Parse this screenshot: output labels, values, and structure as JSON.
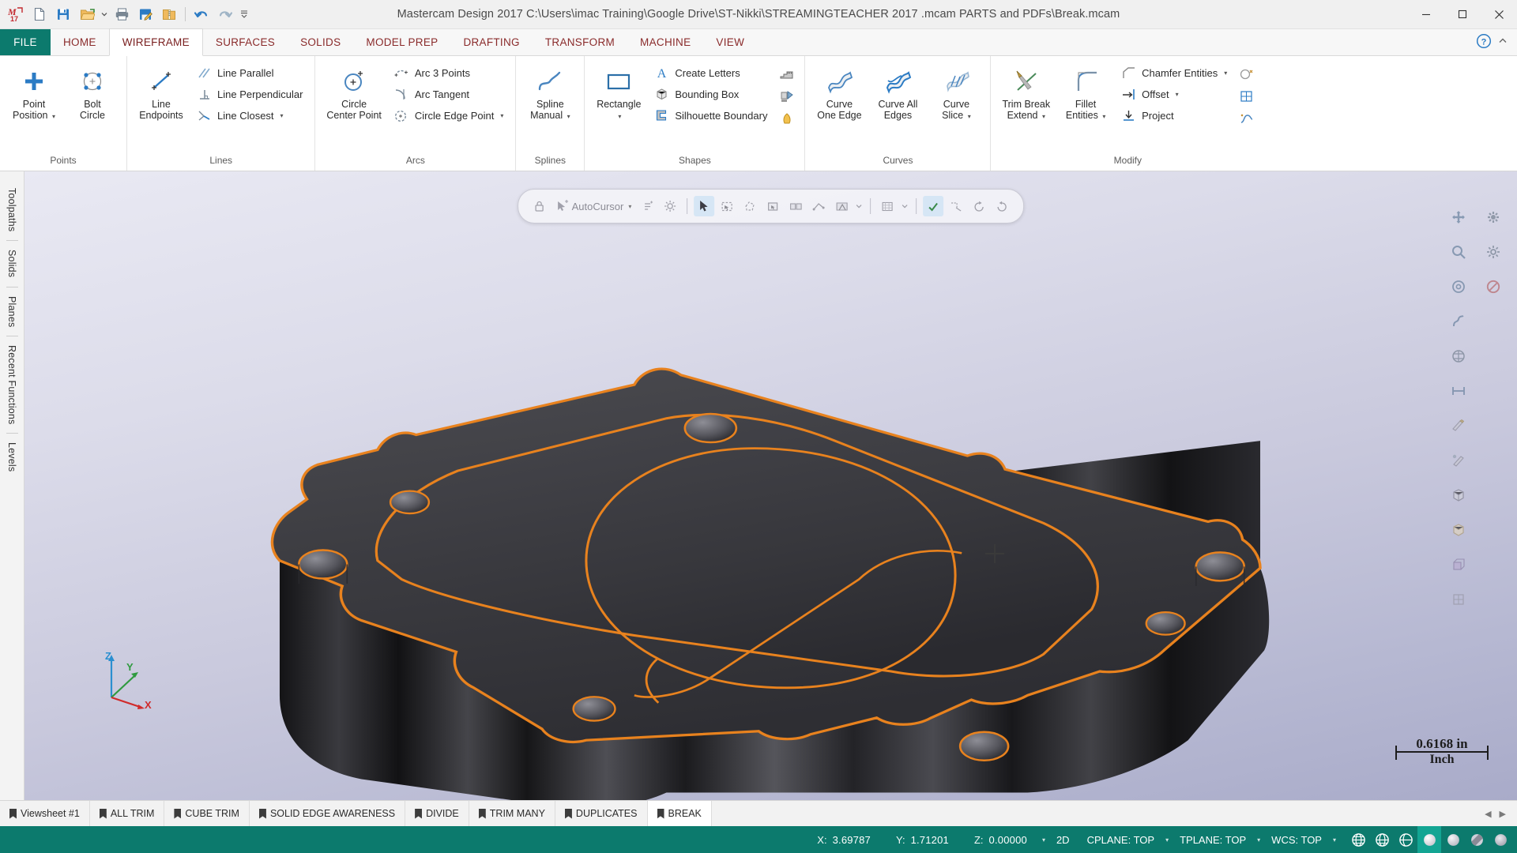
{
  "window": {
    "title": "Mastercam Design 2017  C:\\Users\\imac Training\\Google Drive\\ST-Nikki\\STREAMINGTEACHER 2017 .mcam PARTS and PDFs\\Break.mcam",
    "app_logo": "mastercam-17-logo",
    "minimize": "minimize-icon",
    "maximize": "maximize-icon",
    "close": "close-icon"
  },
  "quick_access": [
    {
      "name": "new-file-icon",
      "tip": "New"
    },
    {
      "name": "save-icon",
      "tip": "Save"
    },
    {
      "name": "open-folder-icon",
      "tip": "Open"
    },
    {
      "name": "open-dropdown-icon",
      "tip": "Open recent"
    },
    {
      "name": "print-icon",
      "tip": "Print"
    },
    {
      "name": "save-as-icon",
      "tip": "Save As"
    },
    {
      "name": "zip2go-icon",
      "tip": "Zip2Go"
    },
    {
      "name": "undo-icon",
      "tip": "Undo"
    },
    {
      "name": "redo-icon",
      "tip": "Redo"
    },
    {
      "name": "customize-qat-icon",
      "tip": "Customize Quick Access Toolbar"
    }
  ],
  "tabs": [
    {
      "label": "FILE",
      "kind": "file"
    },
    {
      "label": "HOME",
      "kind": "normal"
    },
    {
      "label": "WIREFRAME",
      "kind": "active"
    },
    {
      "label": "SURFACES",
      "kind": "normal"
    },
    {
      "label": "SOLIDS",
      "kind": "normal"
    },
    {
      "label": "MODEL PREP",
      "kind": "normal"
    },
    {
      "label": "DRAFTING",
      "kind": "normal"
    },
    {
      "label": "TRANSFORM",
      "kind": "normal"
    },
    {
      "label": "MACHINE",
      "kind": "normal"
    },
    {
      "label": "VIEW",
      "kind": "normal"
    }
  ],
  "help": {
    "icon": "help-question-icon",
    "collapse": "collapse-ribbon-icon"
  },
  "ribbon": {
    "groups": [
      {
        "name": "Points",
        "big": [
          {
            "label": "Point\nPosition",
            "icon": "point-position-icon",
            "caret": true
          },
          {
            "label": "Bolt\nCircle",
            "icon": "bolt-circle-icon",
            "caret": false
          }
        ],
        "small": []
      },
      {
        "name": "Lines",
        "big": [
          {
            "label": "Line\nEndpoints",
            "icon": "line-endpoints-icon",
            "caret": false
          }
        ],
        "small": [
          {
            "label": "Line Parallel",
            "icon": "line-parallel-icon",
            "caret": false
          },
          {
            "label": "Line Perpendicular",
            "icon": "line-perpendicular-icon",
            "caret": false
          },
          {
            "label": "Line Closest",
            "icon": "line-closest-icon",
            "caret": true
          }
        ]
      },
      {
        "name": "Arcs",
        "big": [
          {
            "label": "Circle\nCenter Point",
            "icon": "circle-center-point-icon",
            "caret": false
          }
        ],
        "small": [
          {
            "label": "Arc 3 Points",
            "icon": "arc-3-points-icon",
            "caret": false
          },
          {
            "label": "Arc Tangent",
            "icon": "arc-tangent-icon",
            "caret": false
          },
          {
            "label": "Circle Edge Point",
            "icon": "circle-edge-point-icon",
            "caret": true
          }
        ]
      },
      {
        "name": "Splines",
        "big": [
          {
            "label": "Spline\nManual",
            "icon": "spline-manual-icon",
            "caret": true
          }
        ],
        "small": []
      },
      {
        "name": "Shapes",
        "big": [
          {
            "label": "Rectangle",
            "icon": "rectangle-icon",
            "caret": true
          }
        ],
        "small": [
          {
            "label": "Create Letters",
            "icon": "create-letters-icon",
            "caret": false
          },
          {
            "label": "Bounding Box",
            "icon": "bounding-box-icon",
            "caret": false
          },
          {
            "label": "Silhouette Boundary",
            "icon": "silhouette-boundary-icon",
            "caret": false
          }
        ],
        "icons": [
          {
            "name": "stair-shape-icon"
          },
          {
            "name": "relief-shape-icon"
          },
          {
            "name": "turbine-shape-icon"
          }
        ]
      },
      {
        "name": "Curves",
        "big": [
          {
            "label": "Curve\nOne Edge",
            "icon": "curve-one-edge-icon",
            "caret": false
          },
          {
            "label": "Curve All\nEdges",
            "icon": "curve-all-edges-icon",
            "caret": false
          },
          {
            "label": "Curve\nSlice",
            "icon": "curve-slice-icon",
            "caret": true
          }
        ],
        "small": []
      },
      {
        "name": "Modify",
        "big": [
          {
            "label": "Trim Break\nExtend",
            "icon": "trim-break-extend-icon",
            "caret": true
          },
          {
            "label": "Fillet\nEntities",
            "icon": "fillet-entities-icon",
            "caret": true
          }
        ],
        "small": [
          {
            "label": "Chamfer Entities",
            "icon": "chamfer-entities-icon",
            "caret": true
          },
          {
            "label": "Offset",
            "icon": "offset-icon",
            "caret": true
          },
          {
            "label": "Project",
            "icon": "project-icon",
            "caret": false
          }
        ],
        "icons": [
          {
            "name": "modify-circle-icon"
          },
          {
            "name": "modify-grid-icon"
          },
          {
            "name": "modify-spline-icon"
          }
        ]
      }
    ]
  },
  "left_rail": {
    "tabs": [
      {
        "label": "Toolpaths",
        "name": "sidebar-tab-toolpaths"
      },
      {
        "label": "Solids",
        "name": "sidebar-tab-solids"
      },
      {
        "label": "Planes",
        "name": "sidebar-tab-planes"
      },
      {
        "label": "Recent Functions",
        "name": "sidebar-tab-recent-functions"
      },
      {
        "label": "Levels",
        "name": "sidebar-tab-levels"
      }
    ]
  },
  "selection_toolbar": {
    "autocursor_label": "AutoCursor",
    "items": [
      {
        "name": "lock-icon"
      },
      {
        "name": "autocursor-icon"
      },
      {
        "name": "autocursor-dropdown-icon"
      },
      {
        "name": "autocursor-settings-icon"
      },
      {
        "name": "autocursor-gear-icon"
      },
      {
        "name": "select-arrow-icon"
      },
      {
        "name": "select-window-icon"
      },
      {
        "name": "select-polygon-icon"
      },
      {
        "name": "select-single-icon"
      },
      {
        "name": "select-chain-icon"
      },
      {
        "name": "select-vector-icon"
      },
      {
        "name": "select-area-icon"
      },
      {
        "name": "select-mode-dropdown-icon"
      },
      {
        "name": "select-mask-icon"
      },
      {
        "name": "select-mask-dropdown-icon"
      },
      {
        "name": "end-selection-icon"
      },
      {
        "name": "unselect-all-icon"
      },
      {
        "name": "reselect-icon"
      },
      {
        "name": "undo-selection-icon"
      }
    ]
  },
  "right_toolbar": {
    "rows": [
      [
        {
          "name": "fit-view-icon"
        },
        {
          "name": "view-manager-icon"
        }
      ],
      [
        {
          "name": "zoom-window-icon"
        },
        {
          "name": "view-settings-icon"
        }
      ],
      [
        {
          "name": "zoom-target-icon"
        },
        {
          "name": "no-shade-icon"
        }
      ],
      [
        {
          "name": "dynamic-rotate-icon"
        }
      ],
      [
        {
          "name": "isometric-view-icon"
        }
      ],
      [
        {
          "name": "measure-distance-icon"
        }
      ],
      [
        {
          "name": "analyze-entity-icon"
        }
      ],
      [
        {
          "name": "analyze-chain-icon"
        }
      ],
      [
        {
          "name": "shaded-solid-icon"
        }
      ],
      [
        {
          "name": "shaded-wireframe-icon"
        }
      ],
      [
        {
          "name": "wireframe-view-icon"
        }
      ],
      [
        {
          "name": "render-quality-icon"
        }
      ]
    ]
  },
  "viewport": {
    "scale_value": "0.6168 in",
    "scale_unit": "Inch",
    "gnomon": {
      "x": "X",
      "y": "Y",
      "z": "Z"
    },
    "cursor": {
      "name": "crosshair-cursor"
    }
  },
  "sheet_tabs": [
    {
      "label": "Viewsheet #1",
      "active": false
    },
    {
      "label": "ALL TRIM",
      "active": false
    },
    {
      "label": "CUBE TRIM",
      "active": false
    },
    {
      "label": "SOLID EDGE AWARENESS",
      "active": false
    },
    {
      "label": "DIVIDE",
      "active": false
    },
    {
      "label": "TRIM MANY",
      "active": false
    },
    {
      "label": "DUPLICATES",
      "active": false
    },
    {
      "label": "BREAK",
      "active": true
    }
  ],
  "sheet_nav": {
    "prev": "◀",
    "next": "▶"
  },
  "status_bar": {
    "x_key": "X:",
    "x_value": "3.69787",
    "y_key": "Y:",
    "y_value": "1.71201",
    "z_key": "Z:",
    "z_value": "0.00000",
    "mode_2d": "2D",
    "cplane": "CPLANE: TOP",
    "tplane": "TPLANE: TOP",
    "wcs": "WCS: TOP",
    "icons": [
      {
        "name": "wireframe-display-icon",
        "active": false
      },
      {
        "name": "hidden-lines-icon",
        "active": false
      },
      {
        "name": "hidden-lines-dim-icon",
        "active": false
      },
      {
        "name": "shaded-display-icon",
        "active": true
      },
      {
        "name": "shaded-with-edges-icon",
        "active": false
      },
      {
        "name": "translucent-display-icon",
        "active": false
      },
      {
        "name": "material-display-icon",
        "active": false
      }
    ]
  },
  "colors": {
    "brand_teal": "#0c7a6d",
    "tab_text": "#8a2b2b",
    "geometry_highlight": "#e8821e",
    "part_body": "#3a3a3c"
  }
}
